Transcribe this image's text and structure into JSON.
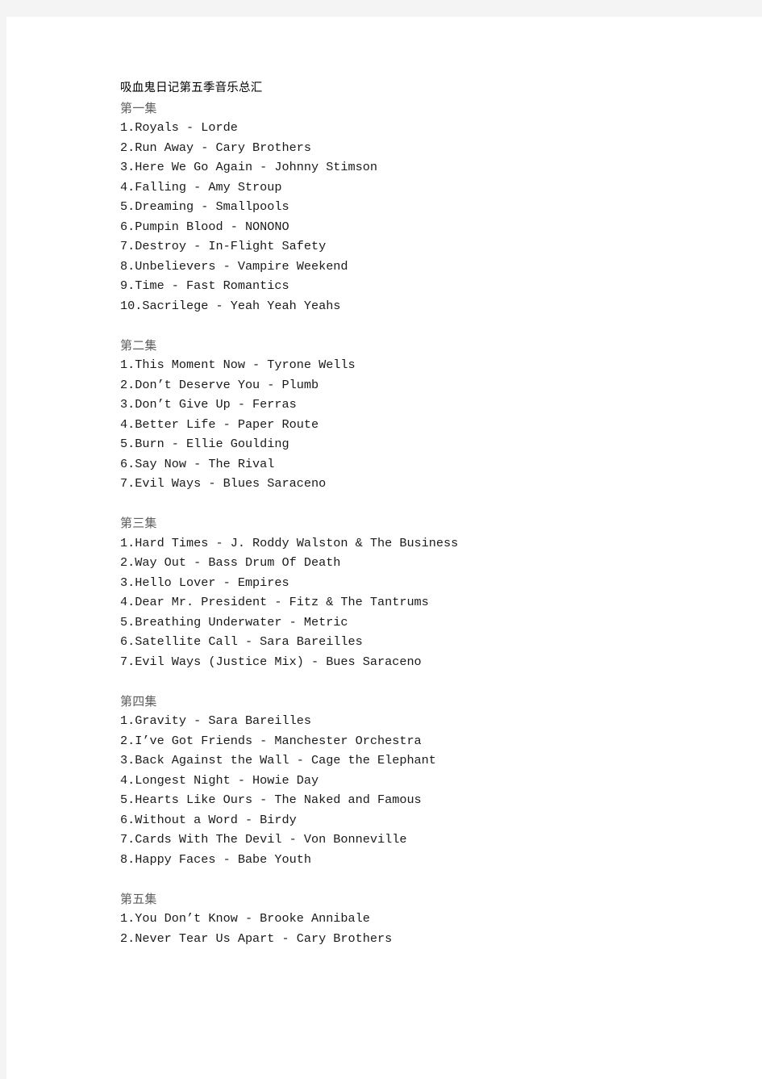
{
  "document": {
    "title": "吸血鬼日记第五季音乐总汇",
    "page_background": "#ffffff",
    "canvas_background": "#f4f4f4",
    "text_color": "#1a1a1a",
    "heading_color": "#5f5f5f",
    "sections": [
      {
        "heading": "第一集",
        "tracks": [
          "1.Royals - Lorde",
          "2.Run Away - Cary Brothers",
          "3.Here We Go Again - Johnny Stimson",
          "4.Falling - Amy Stroup",
          "5.Dreaming - Smallpools",
          "6.Pumpin Blood - NONONO",
          "7.Destroy - In-Flight Safety",
          "8.Unbelievers - Vampire Weekend",
          "9.Time - Fast Romantics",
          "10.Sacrilege - Yeah Yeah Yeahs"
        ]
      },
      {
        "heading": "第二集",
        "tracks": [
          "1.This Moment Now - Tyrone Wells",
          "2.Don’t Deserve You - Plumb",
          "3.Don’t Give Up - Ferras",
          "4.Better Life - Paper Route",
          "5.Burn - Ellie Goulding",
          "6.Say Now - The Rival",
          "7.Evil Ways - Blues Saraceno"
        ]
      },
      {
        "heading": "第三集",
        "tracks": [
          "1.Hard Times - J. Roddy Walston & The Business",
          "2.Way Out - Bass Drum Of Death",
          "3.Hello Lover - Empires",
          "4.Dear Mr. President - Fitz & The Tantrums",
          "5.Breathing Underwater - Metric",
          "6.Satellite Call - Sara Bareilles",
          "7.Evil Ways (Justice Mix) - Bues Saraceno"
        ]
      },
      {
        "heading": "第四集",
        "tracks": [
          "1.Gravity - Sara Bareilles",
          "2.I’ve Got Friends - Manchester Orchestra",
          "3.Back Against the Wall - Cage the Elephant",
          "4.Longest Night - Howie Day",
          "5.Hearts Like Ours - The Naked and Famous",
          "6.Without a Word - Birdy",
          "7.Cards With The Devil - Von Bonneville",
          "8.Happy Faces - Babe Youth"
        ]
      },
      {
        "heading": "第五集",
        "tracks": [
          "1.You Don’t Know - Brooke Annibale",
          "2.Never Tear Us Apart - Cary Brothers"
        ]
      }
    ]
  }
}
